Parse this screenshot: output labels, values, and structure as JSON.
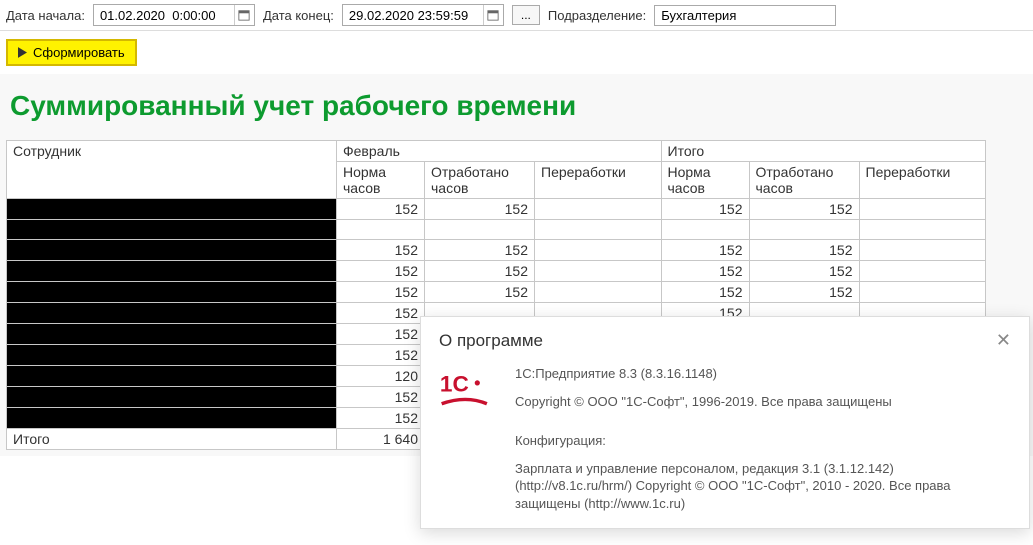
{
  "toolbar": {
    "date_start_label": "Дата начала:",
    "date_start_value": "01.02.2020  0:00:00",
    "date_end_label": "Дата конец:",
    "date_end_value": "29.02.2020 23:59:59",
    "ellipsis": "...",
    "division_label": "Подразделение:",
    "division_value": "Бухгалтерия",
    "generate_label": "Сформировать"
  },
  "report": {
    "title": "Суммированный учет рабочего времени",
    "headers": {
      "employee": "Сотрудник",
      "month": "Февраль",
      "total": "Итого",
      "norm_hours": "Норма часов",
      "worked_hours": "Отработано часов",
      "overtime": "Переработки"
    },
    "rows": [
      {
        "norm": "152",
        "worked": "152",
        "t_norm": "152",
        "t_worked": "152"
      },
      {
        "norm": "",
        "worked": "",
        "t_norm": "",
        "t_worked": ""
      },
      {
        "norm": "152",
        "worked": "152",
        "t_norm": "152",
        "t_worked": "152"
      },
      {
        "norm": "152",
        "worked": "152",
        "t_norm": "152",
        "t_worked": "152"
      },
      {
        "norm": "152",
        "worked": "152",
        "t_norm": "152",
        "t_worked": "152"
      },
      {
        "norm": "152",
        "worked": "",
        "t_norm": "152",
        "t_worked": ""
      },
      {
        "norm": "152",
        "worked": "",
        "t_norm": "",
        "t_worked": ""
      },
      {
        "norm": "152",
        "worked": "",
        "t_norm": "",
        "t_worked": ""
      },
      {
        "norm": "120",
        "worked": "",
        "t_norm": "",
        "t_worked": ""
      },
      {
        "norm": "152",
        "worked": "",
        "t_norm": "",
        "t_worked": ""
      },
      {
        "norm": "152",
        "worked": "",
        "t_norm": "",
        "t_worked": ""
      }
    ],
    "footer": {
      "label": "Итого",
      "total": "1 640"
    }
  },
  "about": {
    "title": "О программе",
    "version": "1С:Предприятие 8.3 (8.3.16.1148)",
    "copyright": "Copyright © ООО \"1С-Софт\", 1996-2019. Все права защищены",
    "config_label": "Конфигурация:",
    "config_text": "Зарплата и управление персоналом, редакция 3.1 (3.1.12.142) (http://v8.1c.ru/hrm/) Copyright © ООО \"1С-Софт\", 2010 - 2020. Все права защищены (http://www.1c.ru)"
  }
}
